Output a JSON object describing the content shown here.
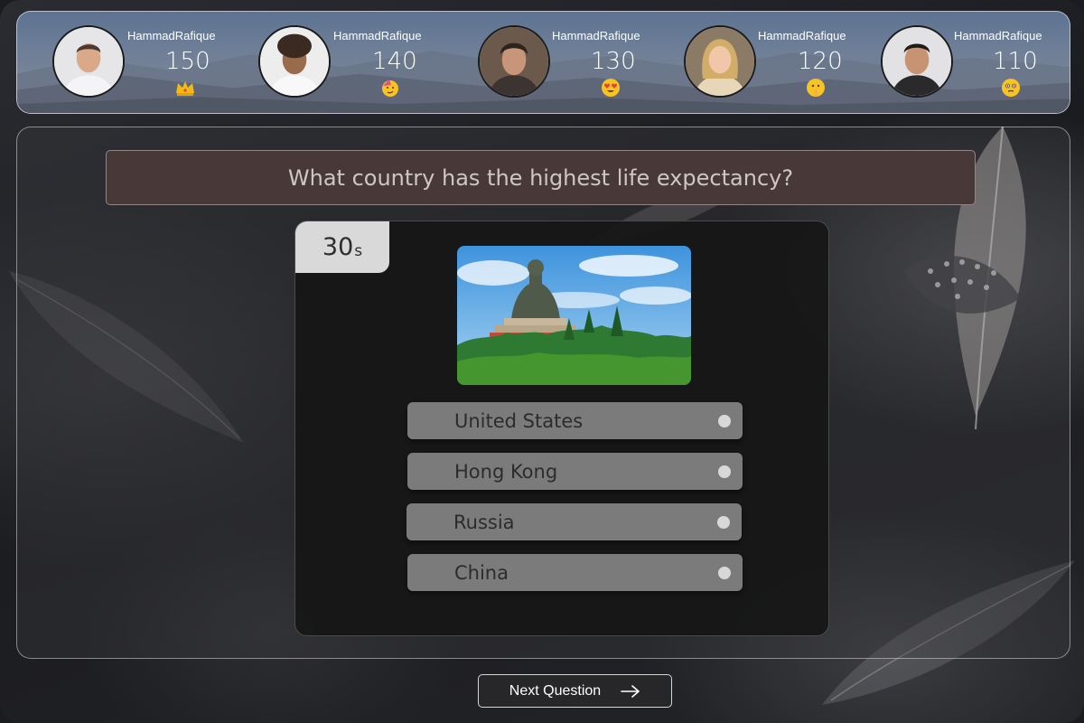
{
  "leaderboard": {
    "players": [
      {
        "name": "HammadRafique",
        "score": "150",
        "emoji": "crown-icon"
      },
      {
        "name": "HammadRafique",
        "score": "140",
        "emoji": "party-face-icon"
      },
      {
        "name": "HammadRafique",
        "score": "130",
        "emoji": "heart-eyes-face-icon"
      },
      {
        "name": "HammadRafique",
        "score": "120",
        "emoji": "shushing-face-icon"
      },
      {
        "name": "HammadRafique",
        "score": "110",
        "emoji": "flushed-face-icon"
      }
    ]
  },
  "quiz": {
    "question": "What country has the highest life expectancy?",
    "timer": {
      "value": "30",
      "unit": "s"
    },
    "image_icon": "big-buddha-photo",
    "options": [
      {
        "label": "United States"
      },
      {
        "label": "Hong Kong"
      },
      {
        "label": "Russia"
      },
      {
        "label": "China"
      }
    ]
  },
  "next_button": {
    "label": "Next Question",
    "icon": "arrow-right-icon"
  },
  "colors": {
    "question_bar": "#483838",
    "card": "#161616",
    "option": "#7b7b7b",
    "timer": "#d9d9d9"
  }
}
